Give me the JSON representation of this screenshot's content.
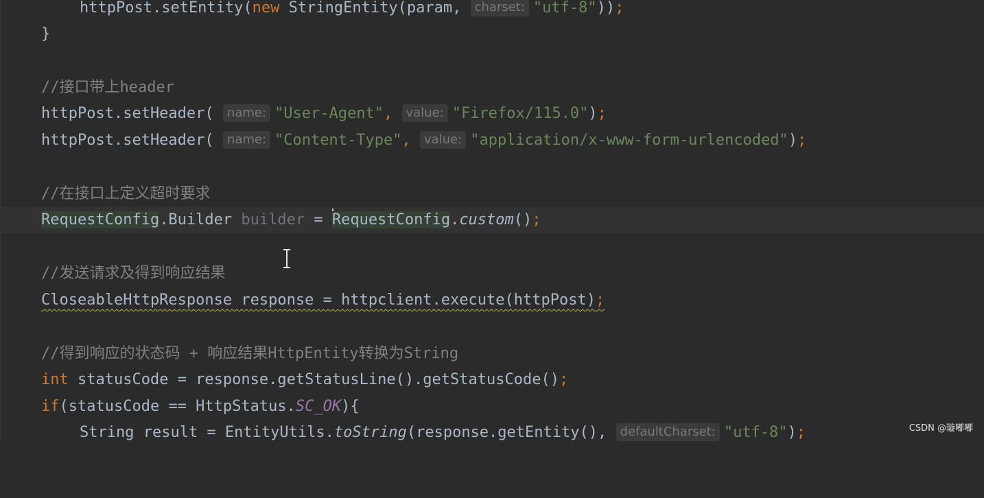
{
  "code": {
    "l1_pre": "httpPost.setEntity(",
    "l1_new": "new",
    "l1_mid": " StringEntity(param,",
    "l1_hint": "charset:",
    "l1_str": "\"utf-8\"",
    "l1_end": "))",
    "semicolon": ";",
    "l2_brace": "}",
    "c1": "//接口带上header",
    "l3_pre": "httpPost.setHeader(",
    "hint_name": "name:",
    "hint_value": "value:",
    "l3_s1": "\"User-Agent\"",
    "comma": ",",
    "l3_s2": "\"Firefox/115.0\"",
    "close_paren": ")",
    "l4_s1": "\"Content-Type\"",
    "l4_s2": "\"application/x-www-form-urlencoded\"",
    "c2": "//在接口上定义超时要求",
    "l5_cls1": "RequestConfig",
    "l5_type_rest": ".Builder ",
    "l5_var": "builder",
    "l5_eq": " = ",
    "l5_cls2": "RequestConfig",
    "l5_dot": ".",
    "l5_method": "custom",
    "l5_call": "()",
    "c3": "//发送请求及得到响应结果",
    "l6_text": "CloseableHttpResponse response = httpclient.execute(httpPost)",
    "c4": "//得到响应的状态码 + 响应结果HttpEntity转换为String",
    "l7_kw": "int",
    "l7_text": " statusCode = response.getStatusLine().getStatusCode()",
    "l8_kw": "if",
    "l8_pre": "(statusCode == HttpStatus.",
    "l8_field": "SC_OK",
    "l8_end": "){",
    "l9_pre": "String result = EntityUtils.",
    "l9_method": "toString",
    "l9_mid": "(response.getEntity(),",
    "l9_hint": "defaultCharset:",
    "l9_str": "\"utf-8\"",
    "l9_end": ")"
  },
  "watermark": "CSDN @璇嘟嘟",
  "colors": {
    "background": "#2b2b2b",
    "keyword": "#cc7832",
    "string": "#6a8759",
    "comment": "#808080",
    "text": "#a9b7c6",
    "static_field": "#9876aa"
  },
  "icons": {
    "cursor": "text-ibeam-cursor"
  }
}
